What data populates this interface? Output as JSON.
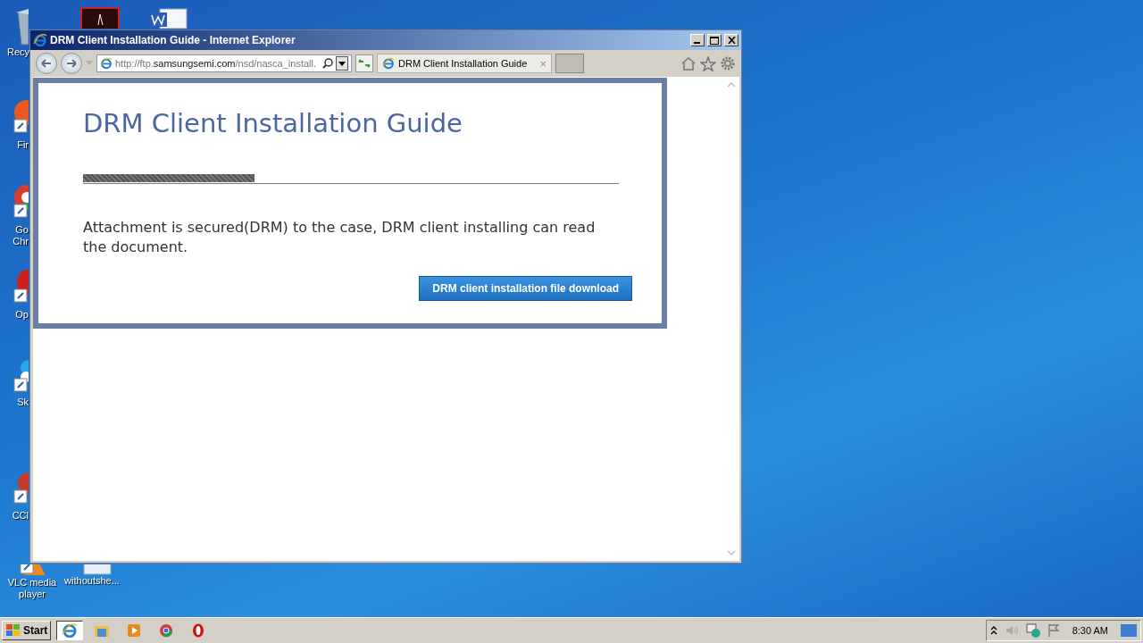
{
  "desktop_icons": [
    {
      "label": "Recy"
    },
    {
      "label": "Fir"
    },
    {
      "label": "Go Chr"
    },
    {
      "label": "Op"
    },
    {
      "label": "Sk"
    },
    {
      "label": "CCl"
    },
    {
      "label": "VLC media player"
    },
    {
      "label": "withoutshe..."
    }
  ],
  "window": {
    "title": "DRM Client Installation Guide - Internet Explorer",
    "address": {
      "scheme": "http://ftp.",
      "domain": "samsungsemi.com",
      "path": "/nsd/nasca_install."
    },
    "tabs": [
      {
        "label": "DRM Client Installation Guide",
        "close": "×",
        "selected": true
      }
    ]
  },
  "page": {
    "heading": "DRM Client Installation Guide",
    "progress": {
      "level": 0.32
    },
    "message": "Attachment is secured(DRM) to the case, DRM client installing can read the document.",
    "button": "DRM client installation file download"
  },
  "taskbar": {
    "start": "Start",
    "pinned": [
      {
        "selected": true
      },
      {
        "selected": false
      },
      {
        "selected": false
      },
      {
        "selected": false
      },
      {
        "selected": false
      }
    ],
    "clock": "8:30 AM"
  }
}
